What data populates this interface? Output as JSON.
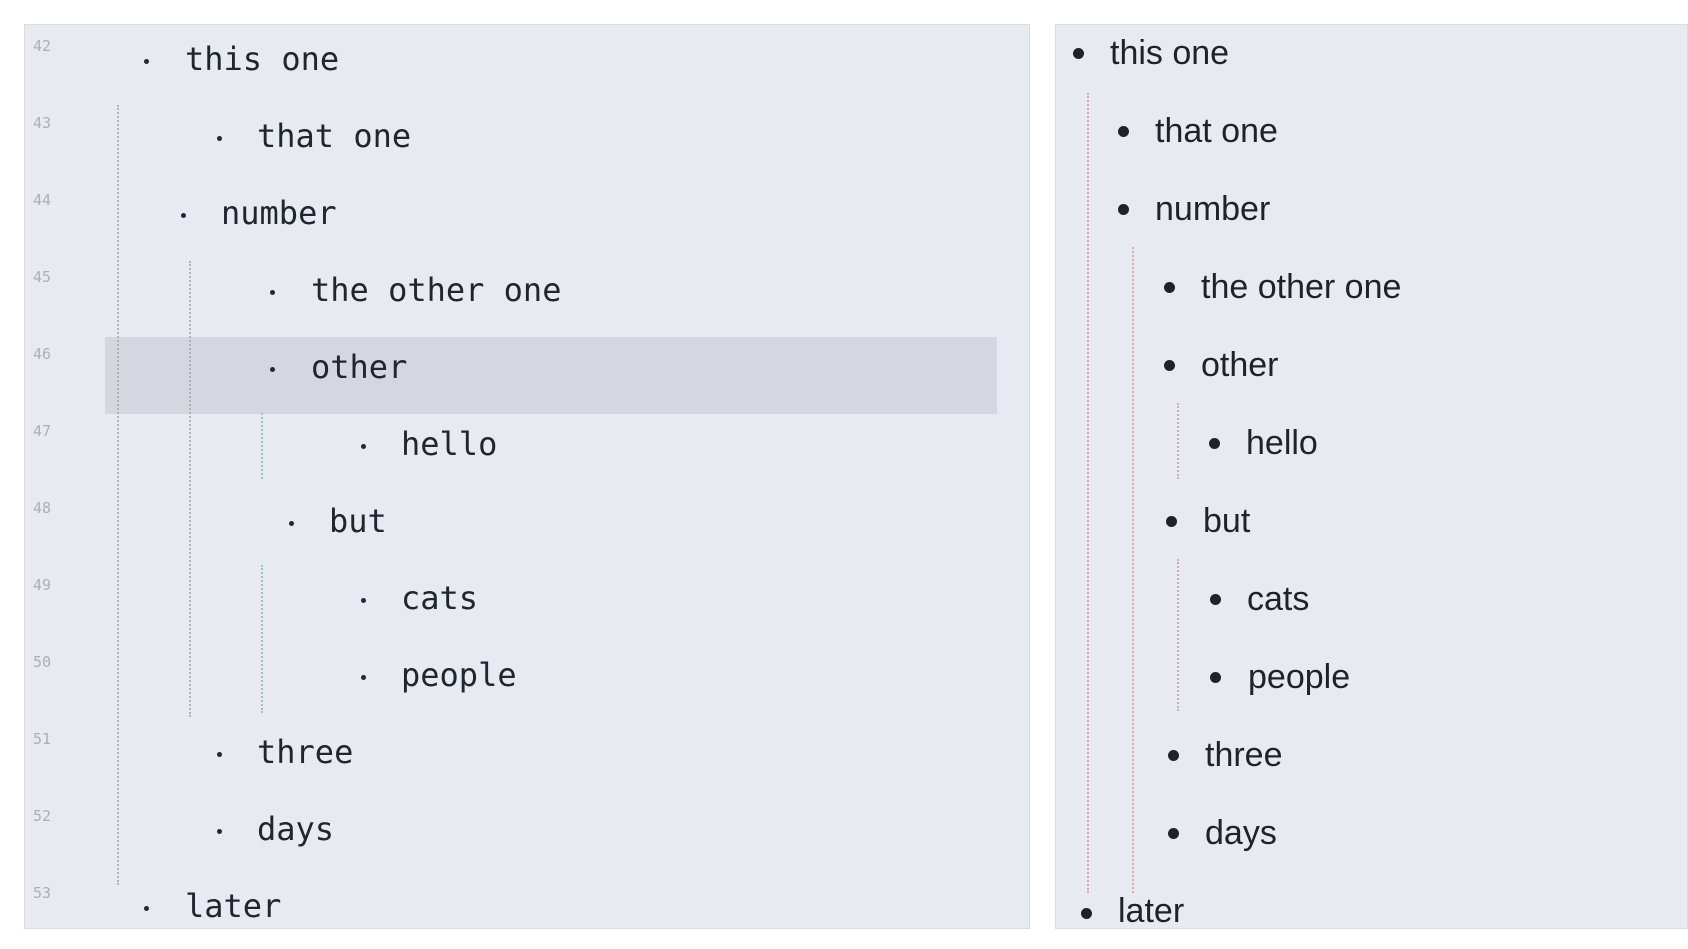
{
  "editor": {
    "lines": [
      {
        "num": "42",
        "text": "this one"
      },
      {
        "num": "43",
        "text": "that one"
      },
      {
        "num": "44",
        "text": "number"
      },
      {
        "num": "45",
        "text": "the other one"
      },
      {
        "num": "46",
        "text": "other"
      },
      {
        "num": "47",
        "text": "hello"
      },
      {
        "num": "48",
        "text": "but"
      },
      {
        "num": "49",
        "text": "cats"
      },
      {
        "num": "50",
        "text": "people"
      },
      {
        "num": "51",
        "text": "three"
      },
      {
        "num": "52",
        "text": "days"
      },
      {
        "num": "53",
        "text": "later"
      }
    ]
  },
  "preview": {
    "items": [
      "this one",
      "that one",
      "number",
      "the other one",
      "other",
      "hello",
      "but",
      "cats",
      "people",
      "three",
      "days",
      "later"
    ]
  }
}
